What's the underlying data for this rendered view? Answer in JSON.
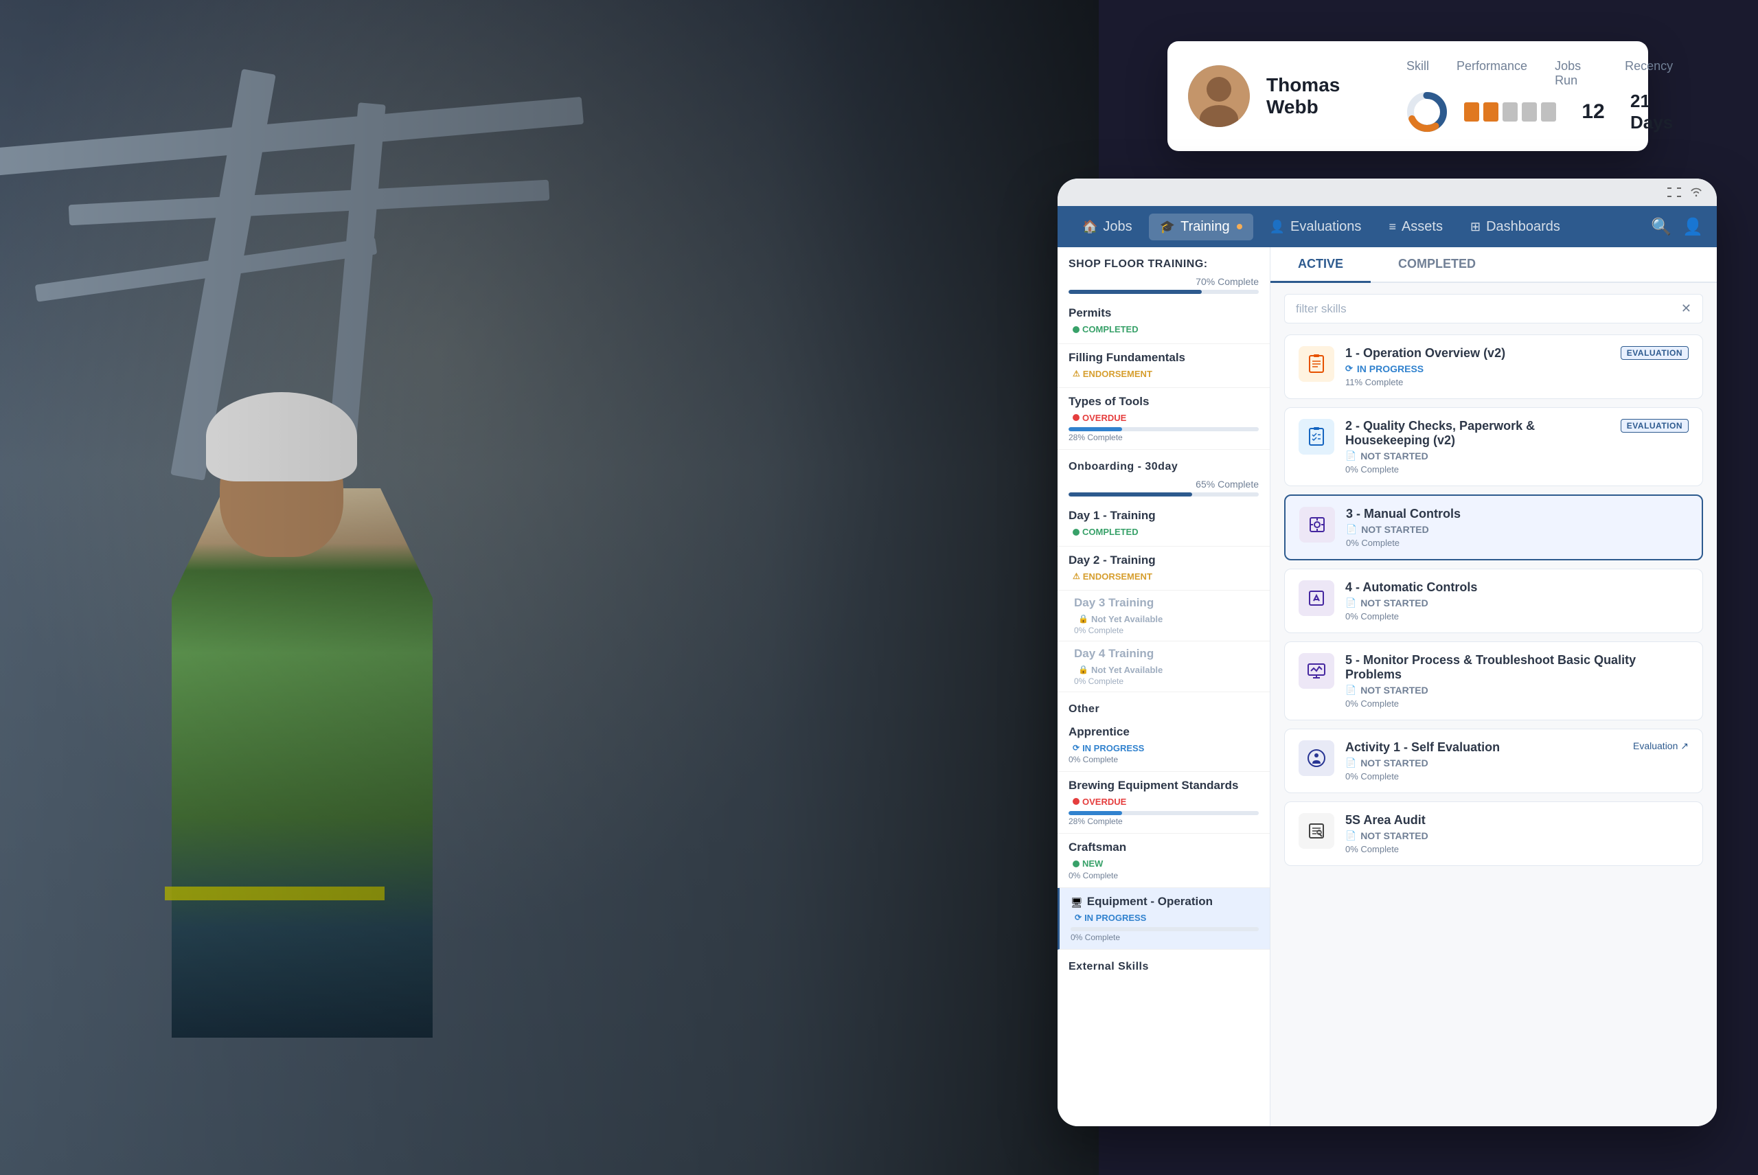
{
  "profile_card": {
    "name": "Thomas Webb",
    "metric_headers": [
      "Skill",
      "Performance",
      "Jobs Run",
      "Recency"
    ],
    "jobs_run": "12",
    "recency": "21 Days",
    "performance_bars": [
      {
        "color": "#e07820",
        "filled": true
      },
      {
        "color": "#e07820",
        "filled": true
      },
      {
        "color": "#c0c0c0",
        "filled": false
      },
      {
        "color": "#c0c0c0",
        "filled": false
      },
      {
        "color": "#c0c0c0",
        "filled": false
      }
    ]
  },
  "nav": {
    "items": [
      {
        "id": "jobs",
        "label": "Jobs",
        "icon": "🏠"
      },
      {
        "id": "training",
        "label": "Training",
        "icon": "🎓",
        "active": true,
        "has_dot": true
      },
      {
        "id": "evaluations",
        "label": "Evaluations",
        "icon": "👤"
      },
      {
        "id": "assets",
        "label": "Assets",
        "icon": "≡"
      },
      {
        "id": "dashboards",
        "label": "Dashboards",
        "icon": "⊞"
      }
    ]
  },
  "tabs": [
    {
      "id": "active",
      "label": "ACTIVE",
      "active": true
    },
    {
      "id": "completed",
      "label": "COMPLETED",
      "active": false
    }
  ],
  "filter": {
    "placeholder": "filter skills"
  },
  "sidebar": {
    "sections": [
      {
        "id": "shop-floor",
        "title": "SHOP FLOOR TRAINING:",
        "progress_label": "70% Complete",
        "progress_pct": 70,
        "items": [
          {
            "id": "permits",
            "label": "Permits",
            "status": "COMPLETED",
            "status_type": "completed",
            "show_progress": false
          },
          {
            "id": "filling",
            "label": "Filling Fundamentals",
            "status": "ENDORSEMENT",
            "status_type": "endorsement",
            "show_progress": false
          },
          {
            "id": "tools",
            "label": "Types of Tools",
            "status": "OVERDUE",
            "status_type": "overdue",
            "progress": 28,
            "progress_label": "28% Complete"
          }
        ]
      },
      {
        "id": "onboarding",
        "title": "Onboarding - 30day",
        "progress_label": "65% Complete",
        "progress_pct": 65,
        "items": [
          {
            "id": "day1",
            "label": "Day 1 - Training",
            "status": "COMPLETED",
            "status_type": "completed"
          },
          {
            "id": "day2",
            "label": "Day 2 - Training",
            "status": "ENDORSEMENT",
            "status_type": "endorsement"
          },
          {
            "id": "day3",
            "label": "Day 3 Training",
            "status": "Not Yet Available",
            "status_type": "not-available",
            "locked": true,
            "progress_label": "0% Complete"
          },
          {
            "id": "day4",
            "label": "Day 4 Training",
            "status": "Not Yet Available",
            "status_type": "not-available",
            "locked": true,
            "progress_label": "0% Complete"
          }
        ]
      },
      {
        "id": "other",
        "title": "Other",
        "items": [
          {
            "id": "apprentice",
            "label": "Apprentice",
            "status": "IN PROGRESS",
            "status_type": "in-progress",
            "progress": 0,
            "progress_label": "0% Complete"
          },
          {
            "id": "brewing",
            "label": "Brewing Equipment Standards",
            "status": "OVERDUE",
            "status_type": "overdue",
            "progress": 28,
            "progress_label": "28% Complete"
          },
          {
            "id": "craftsman",
            "label": "Craftsman",
            "status": "NEW",
            "status_type": "new",
            "progress": 0,
            "progress_label": "0% Complete"
          },
          {
            "id": "equipment-op",
            "label": "Equipment - Operation",
            "status": "IN PROGRESS",
            "status_type": "in-progress",
            "progress": 0,
            "progress_label": "0% Complete",
            "selected": true
          }
        ]
      },
      {
        "id": "external",
        "title": "External Skills"
      }
    ]
  },
  "skills": [
    {
      "id": "skill-1",
      "number": "1",
      "name": "1 - Operation Overview (v2)",
      "status": "IN PROGRESS",
      "status_type": "in-progress",
      "progress": "11% Complete",
      "icon_type": "orange",
      "has_evaluation": true,
      "evaluation_label": "EVALUATION"
    },
    {
      "id": "skill-2",
      "number": "2",
      "name": "2 - Quality Checks, Paperwork & Housekeeping (v2)",
      "status": "NOT STARTED",
      "status_type": "not-started",
      "progress": "0% Complete",
      "icon_type": "blue",
      "has_evaluation": true,
      "evaluation_label": "EVALUATION"
    },
    {
      "id": "skill-3",
      "number": "3",
      "name": "3 - Manual Controls",
      "status": "NOT STARTED",
      "status_type": "not-started",
      "progress": "0% Complete",
      "icon_type": "purple",
      "has_evaluation": false,
      "highlighted": true
    },
    {
      "id": "skill-4",
      "number": "4",
      "name": "4 - Automatic Controls",
      "status": "NOT STARTED",
      "status_type": "not-started",
      "progress": "0% Complete",
      "icon_type": "purple",
      "has_evaluation": false
    },
    {
      "id": "skill-5",
      "number": "5",
      "name": "5 - Monitor Process & Troubleshoot Basic Quality Problems",
      "status": "NOT STARTED",
      "status_type": "not-started",
      "progress": "0% Complete",
      "icon_type": "purple",
      "has_evaluation": false
    },
    {
      "id": "activity-1",
      "number": "A1",
      "name": "Activity 1 - Self Evaluation",
      "status": "NOT STARTED",
      "status_type": "not-started",
      "progress": "0% Complete",
      "icon_type": "dark",
      "has_evaluation": true,
      "evaluation_label": "Evaluation"
    },
    {
      "id": "5s-audit",
      "number": "5S",
      "name": "5S Area Audit",
      "status": "NOT STARTED",
      "status_type": "not-started",
      "progress": "0% Complete",
      "icon_type": "gray",
      "has_evaluation": false
    }
  ]
}
